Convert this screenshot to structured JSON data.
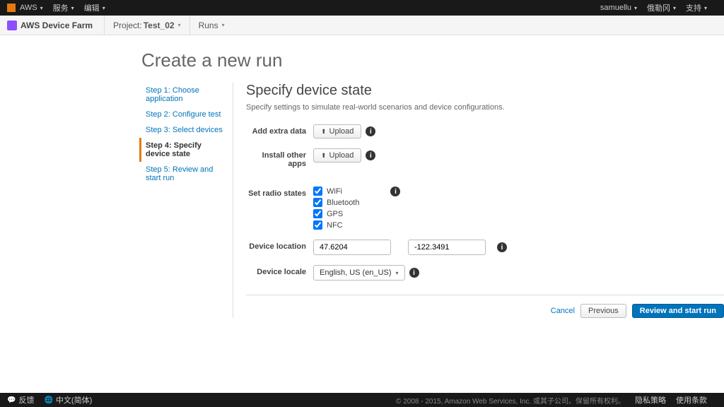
{
  "topbar": {
    "brand": "AWS",
    "services": "服务",
    "edit": "编辑",
    "user": "samuellu",
    "region": "俄勒冈",
    "support": "支持"
  },
  "svcbar": {
    "service": "AWS Device Farm",
    "project_prefix": "Project: ",
    "project_name": "Test_02",
    "nav_runs": "Runs"
  },
  "page_title": "Create a new run",
  "steps": [
    "Step 1: Choose application",
    "Step 2: Configure test",
    "Step 3: Select devices",
    "Step 4: Specify device state",
    "Step 5: Review and start run"
  ],
  "active_step_index": 3,
  "panel": {
    "heading": "Specify device state",
    "subtitle": "Specify settings to simulate real-world scenarios and device configurations.",
    "labels": {
      "add_extra": "Add extra data",
      "install_other": "Install other apps",
      "radio_states": "Set radio states",
      "device_location": "Device location",
      "device_locale": "Device locale"
    },
    "upload_btn": "Upload",
    "radios": {
      "wifi": "WiFi",
      "bluetooth": "Bluetooth",
      "gps": "GPS",
      "nfc": "NFC"
    },
    "location_lat": "47.6204",
    "location_lon": "-122.3491",
    "locale_selected": "English, US (en_US)"
  },
  "actions": {
    "cancel": "Cancel",
    "previous": "Previous",
    "review": "Review and start run"
  },
  "footer": {
    "feedback": "反馈",
    "language": "中文(简体)",
    "copyright": "© 2008 - 2015, Amazon Web Services, Inc. 或其子公司。保留所有权利。",
    "privacy": "隐私策略",
    "terms": "使用条款"
  }
}
